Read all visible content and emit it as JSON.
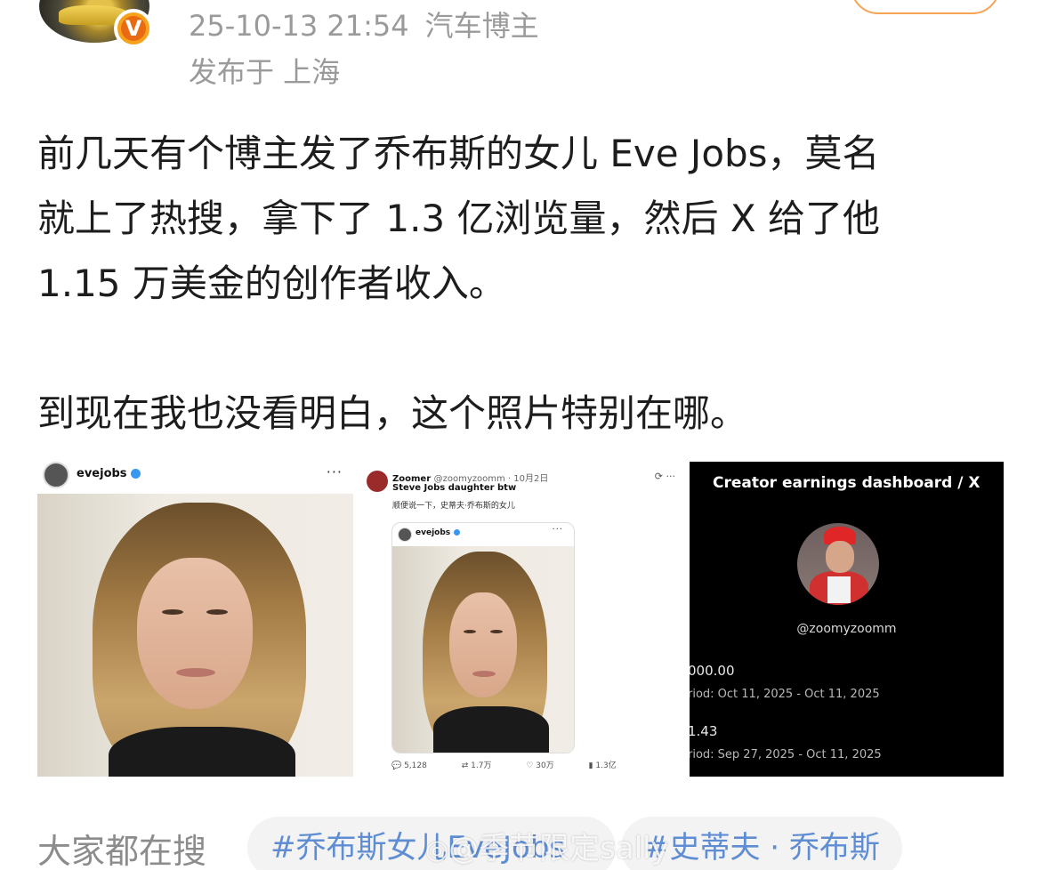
{
  "header": {
    "timestamp": "25-10-13 21:54",
    "author_tag": "汽车博主",
    "location": "发布于 上海",
    "verified_badge": "V"
  },
  "post": {
    "lines": [
      "前几天有个博主发了乔布斯的女儿 Eve Jobs，莫名",
      "就上了热搜，拿下了 1.3 亿浏览量，然后 X 给了他",
      "1.15 万美金的创作者收入。",
      "到现在我也没看明白，这个照片特别在哪。"
    ]
  },
  "images": {
    "ig": {
      "username": "evejobs",
      "more": "···"
    },
    "tweet": {
      "name": "Zoomer",
      "handle": "@zoomyzoomm · 10月2日",
      "title": "Steve Jobs daughter btw",
      "translation": "顺便说一下，史蒂夫·乔布斯的女儿",
      "card_username": "evejobs",
      "stats": [
        "5,128",
        "1.7万",
        "30万",
        "1.3亿"
      ]
    },
    "earnings": {
      "title": "Creator earnings dashboard / X",
      "handle": "@zoomyzoomm",
      "amount1": "000.00",
      "period1": "riod: Oct 11, 2025 - Oct 11, 2025",
      "amount2": "1.43",
      "period2": "riod: Sep 27, 2025 - Oct 11, 2025"
    }
  },
  "footer": {
    "search_label": "大家都在搜",
    "tags": [
      "#乔布斯女儿EveJobs",
      "#史蒂夫 · 乔布斯"
    ],
    "watermark": "@季节限定sally"
  }
}
